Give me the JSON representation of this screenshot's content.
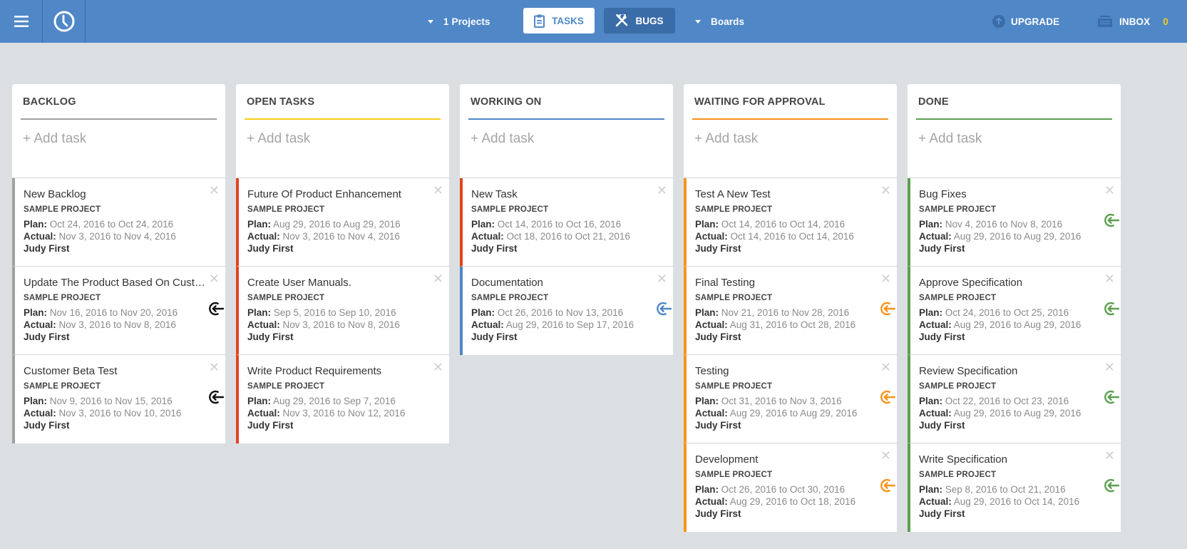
{
  "topbar": {
    "menu_icon": "hamburger-menu-icon",
    "timer_icon": "clock-icon",
    "projects_label": "1 Projects",
    "tabs": [
      {
        "label": "TASKS",
        "icon": "clipboard-icon",
        "active": true
      },
      {
        "label": "BUGS",
        "icon": "tools-icon",
        "active": false
      }
    ],
    "boards_label": "Boards",
    "upgrade_label": "UPGRADE",
    "inbox_label": "INBOX",
    "inbox_count": "0"
  },
  "colors": {
    "topbar": "#4f87c7",
    "backlog": "#a0a0a0",
    "open": "#f5cd1a",
    "open_card": "#e0441f",
    "working": "#4f87c7",
    "waiting": "#f7941d",
    "done": "#5ba04f",
    "inbox_count": "#f5cd1a"
  },
  "board": {
    "add_task_label": "+ Add task",
    "columns": [
      {
        "title": "BACKLOG",
        "line_color": "#a0a0a0",
        "cards": [
          {
            "title": "New Backlog",
            "project": "SAMPLE PROJECT",
            "plan": "Oct 24, 2016 to Oct 24, 2016",
            "actual": "Nov 3, 2016 to Nov 4, 2016",
            "owner": "Judy First",
            "accent": "#a0a0a0",
            "move_back": false,
            "move_color": "#111111"
          },
          {
            "title": "Update The Product Based On Custo...",
            "project": "SAMPLE PROJECT",
            "plan": "Nov 16, 2016 to Nov 20, 2016",
            "actual": "Nov 3, 2016 to Nov 8, 2016",
            "owner": "Judy First",
            "accent": "#a0a0a0",
            "move_back": true,
            "move_color": "#111111"
          },
          {
            "title": "Customer Beta Test",
            "project": "SAMPLE PROJECT",
            "plan": "Nov 9, 2016 to Nov 15, 2016",
            "actual": "Nov 3, 2016 to Nov 10, 2016",
            "owner": "Judy First",
            "accent": "#a0a0a0",
            "move_back": true,
            "move_color": "#111111"
          }
        ]
      },
      {
        "title": "OPEN TASKS",
        "line_color": "#f5cd1a",
        "cards": [
          {
            "title": "Future Of Product Enhancement",
            "project": "SAMPLE PROJECT",
            "plan": "Aug 29, 2016 to Aug 29, 2016",
            "actual": "Nov 3, 2016 to Nov 4, 2016",
            "owner": "Judy First",
            "accent": "#e0441f",
            "move_back": false,
            "move_color": "#f5cd1a"
          },
          {
            "title": "Create User Manuals.",
            "project": "SAMPLE PROJECT",
            "plan": "Sep 5, 2016 to Sep 10, 2016",
            "actual": "Nov 3, 2016 to Nov 8, 2016",
            "owner": "Judy First",
            "accent": "#e0441f",
            "move_back": false,
            "move_color": "#f5cd1a"
          },
          {
            "title": "Write Product Requirements",
            "project": "SAMPLE PROJECT",
            "plan": "Aug 29, 2016 to Sep 7, 2016",
            "actual": "Nov 3, 2016 to Nov 12, 2016",
            "owner": "Judy First",
            "accent": "#e0441f",
            "move_back": false,
            "move_color": "#f5cd1a"
          }
        ]
      },
      {
        "title": "WORKING ON",
        "line_color": "#4f87c7",
        "cards": [
          {
            "title": "New Task",
            "project": "SAMPLE PROJECT",
            "plan": "Oct 14, 2016 to Oct 16, 2016",
            "actual": "Oct 18, 2016 to Oct 21, 2016",
            "owner": "Judy First",
            "accent": "#e0441f",
            "move_back": false,
            "move_color": "#4f87c7"
          },
          {
            "title": "Documentation",
            "project": "SAMPLE PROJECT",
            "plan": "Oct 26, 2016 to Nov 13, 2016",
            "actual": "Aug 29, 2016 to Sep 17, 2016",
            "owner": "Judy First",
            "accent": "#4f87c7",
            "move_back": true,
            "move_color": "#4f87c7"
          }
        ]
      },
      {
        "title": "WAITING FOR APPROVAL",
        "line_color": "#f7941d",
        "cards": [
          {
            "title": "Test A New Test",
            "project": "SAMPLE PROJECT",
            "plan": "Oct 14, 2016 to Oct 14, 2016",
            "actual": "Oct 14, 2016 to Oct 14, 2016",
            "owner": "Judy First",
            "accent": "#f7941d",
            "move_back": false,
            "move_color": "#f7941d"
          },
          {
            "title": "Final Testing",
            "project": "SAMPLE PROJECT",
            "plan": "Nov 21, 2016 to Nov 28, 2016",
            "actual": "Aug 31, 2016 to Oct 28, 2016",
            "owner": "Judy First",
            "accent": "#f7941d",
            "move_back": true,
            "move_color": "#f7941d"
          },
          {
            "title": "Testing",
            "project": "SAMPLE PROJECT",
            "plan": "Oct 31, 2016 to Nov 3, 2016",
            "actual": "Aug 29, 2016 to Aug 29, 2016",
            "owner": "Judy First",
            "accent": "#f7941d",
            "move_back": true,
            "move_color": "#f7941d"
          },
          {
            "title": "Development",
            "project": "SAMPLE PROJECT",
            "plan": "Oct 26, 2016 to Oct 30, 2016",
            "actual": "Aug 29, 2016 to Oct 18, 2016",
            "owner": "Judy First",
            "accent": "#f7941d",
            "move_back": true,
            "move_color": "#f7941d"
          }
        ]
      },
      {
        "title": "DONE",
        "line_color": "#5ba04f",
        "cards": [
          {
            "title": "Bug Fixes",
            "project": "SAMPLE PROJECT",
            "plan": "Nov 4, 2016 to Nov 8, 2016",
            "actual": "Aug 29, 2016 to Aug 29, 2016",
            "owner": "Judy First",
            "accent": "#5ba04f",
            "move_back": true,
            "move_color": "#5ba04f"
          },
          {
            "title": "Approve Specification",
            "project": "SAMPLE PROJECT",
            "plan": "Oct 24, 2016 to Oct 25, 2016",
            "actual": "Aug 29, 2016 to Aug 29, 2016",
            "owner": "Judy First",
            "accent": "#5ba04f",
            "move_back": true,
            "move_color": "#5ba04f"
          },
          {
            "title": "Review Specification",
            "project": "SAMPLE PROJECT",
            "plan": "Oct 22, 2016 to Oct 23, 2016",
            "actual": "Aug 29, 2016 to Aug 29, 2016",
            "owner": "Judy First",
            "accent": "#5ba04f",
            "move_back": true,
            "move_color": "#5ba04f"
          },
          {
            "title": "Write Specification",
            "project": "SAMPLE PROJECT",
            "plan": "Sep 8, 2016 to Oct 21, 2016",
            "actual": "Aug 29, 2016 to Oct 14, 2016",
            "owner": "Judy First",
            "accent": "#5ba04f",
            "move_back": true,
            "move_color": "#5ba04f"
          }
        ]
      }
    ],
    "labels": {
      "plan": "Plan:",
      "actual": "Actual:",
      "close": "✕"
    }
  }
}
